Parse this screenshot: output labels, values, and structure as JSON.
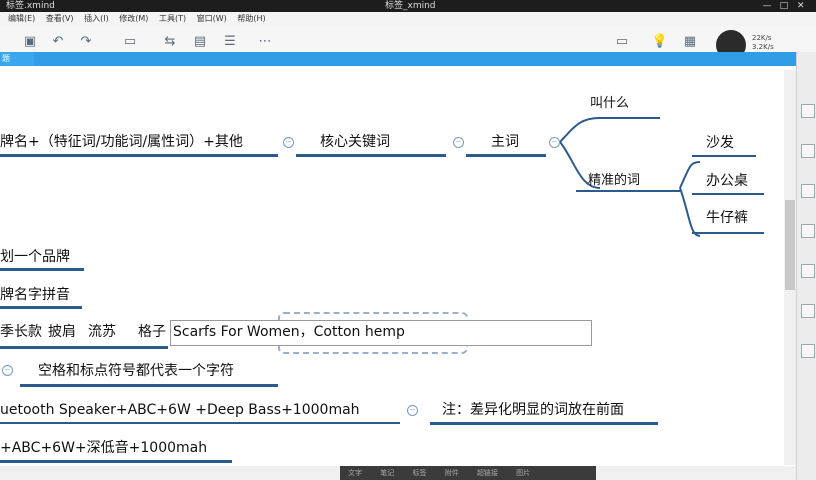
{
  "window": {
    "title": "标签.xmind",
    "center_title": "标签_xmind",
    "controls": [
      "—",
      "□",
      "✕"
    ]
  },
  "menu": [
    "编辑(E)",
    "查看(V)",
    "插入(I)",
    "修改(M)",
    "工具(T)",
    "窗口(W)",
    "帮助(H)"
  ],
  "toolbar": {
    "zoom_line1": "22K/s",
    "zoom_line2": "3.2K/s"
  },
  "tab": {
    "label": "题"
  },
  "status": {
    "items": [
      "文字",
      "笔记",
      "标签",
      "附件",
      "超链接",
      "图片"
    ]
  },
  "mindmap": {
    "formula": "牌名+（特征词/功能词/属性词）+其他",
    "core_keyword": "核心关键词",
    "main_word": "主词",
    "what_called": "叫什么",
    "precise_word": "精准的词",
    "leaf1": "沙发",
    "leaf2": "办公桌",
    "leaf3": "牛仔裤",
    "line_brand": "划一个品牌",
    "line_pinyin": "牌名字拼音",
    "line_style_a": "季长款",
    "line_style_b": "披肩",
    "line_style_c": "流苏",
    "line_style_d": "格子",
    "edit_text": "Scarfs For Women，Cotton hemp",
    "space_note": "空格和标点符号都代表一个字符",
    "bluetooth": "uetooth   Speaker+ABC+6W +Deep  Bass+1000mah",
    "diff_note": "注：差异化明显的词放在前面",
    "bottom_line": "+ABC+6W+深低音+1000mah"
  },
  "colors": {
    "underline": "#2d5a8c",
    "branch": "#2d5a8c",
    "tabbar": "#2f9ee6"
  }
}
